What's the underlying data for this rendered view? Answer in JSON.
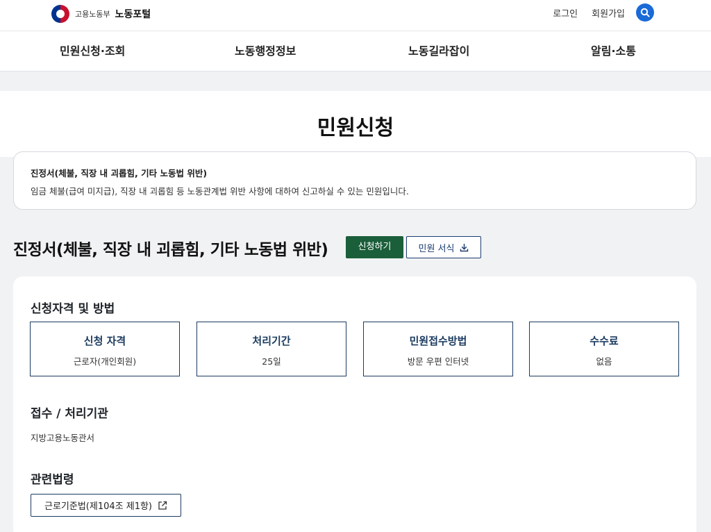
{
  "header": {
    "ministry": "고용노동부",
    "portal": "노동포털",
    "login": "로그인",
    "signup": "회원가입",
    "search_icon": "search-icon",
    "accent_color": "#1a6ad8"
  },
  "nav": {
    "items": [
      "민원신청·조회",
      "노동행정정보",
      "노동길라잡이",
      "알림·소통"
    ]
  },
  "page": {
    "title": "민원신청"
  },
  "intro": {
    "title": "진정서(체불, 직장 내 괴롭힘, 기타 노동법 위반)",
    "description": "임금 체불(급여 미지급), 직장 내 괴롭힘 등 노동관계법 위반 사항에 대하여 신고하실 수 있는 민원입니다."
  },
  "petition": {
    "title": "진정서(체불, 직장 내 괴롭힘, 기타 노동법 위반)",
    "apply_label": "신청하기",
    "form_label": "민원 서식",
    "apply_color": "#1b5e3a"
  },
  "eligibility": {
    "heading": "신청자격 및 방법",
    "boxes": [
      {
        "label": "신청 자격",
        "value": "근로자(개인회원)"
      },
      {
        "label": "처리기간",
        "value": "25일"
      },
      {
        "label": "민원접수방법",
        "value": "방문 우편 인터넷"
      },
      {
        "label": "수수료",
        "value": "없음"
      }
    ]
  },
  "agency": {
    "heading": "접수 / 처리기관",
    "value": "지방고용노동관서"
  },
  "law": {
    "heading": "관련법령",
    "link_label": "근로기준법(제104조 제1항)"
  }
}
